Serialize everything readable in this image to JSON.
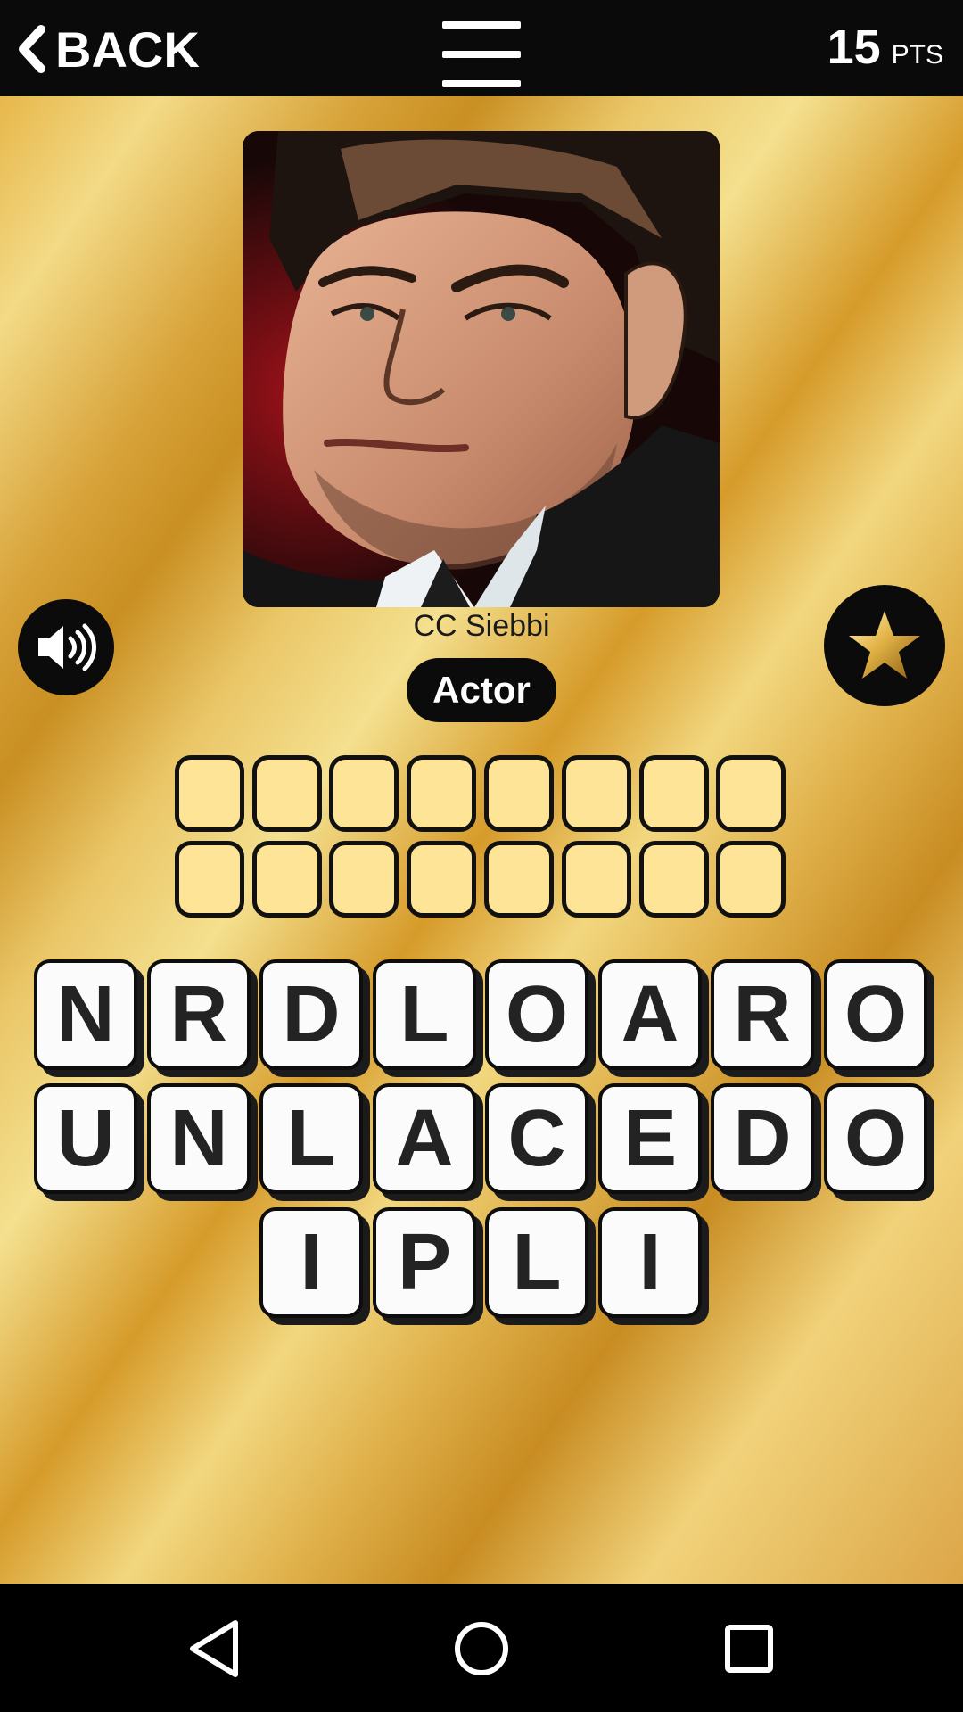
{
  "header": {
    "back_label": "BACK",
    "points": "15",
    "points_unit": "PTS"
  },
  "puzzle": {
    "credit": "CC Siebbi",
    "category": "Actor",
    "answer_rows": [
      8,
      8
    ]
  },
  "letters": {
    "row1": [
      "N",
      "R",
      "D",
      "L",
      "O",
      "A",
      "R",
      "O"
    ],
    "row2": [
      "U",
      "N",
      "L",
      "A",
      "C",
      "E",
      "D",
      "O"
    ],
    "row3": [
      "I",
      "P",
      "L",
      "I"
    ]
  },
  "icons": {
    "back": "chevron-left-icon",
    "menu": "hamburger-menu-icon",
    "sound": "speaker-icon",
    "star": "gold-star-icon",
    "nav_back": "triangle-back-icon",
    "nav_home": "circle-home-icon",
    "nav_recent": "square-recents-icon"
  },
  "colors": {
    "slot_fill": "#fde497",
    "tile_fill": "#fbfbfb",
    "bar": "#0a0a0a",
    "gold": "#d9a53a"
  }
}
